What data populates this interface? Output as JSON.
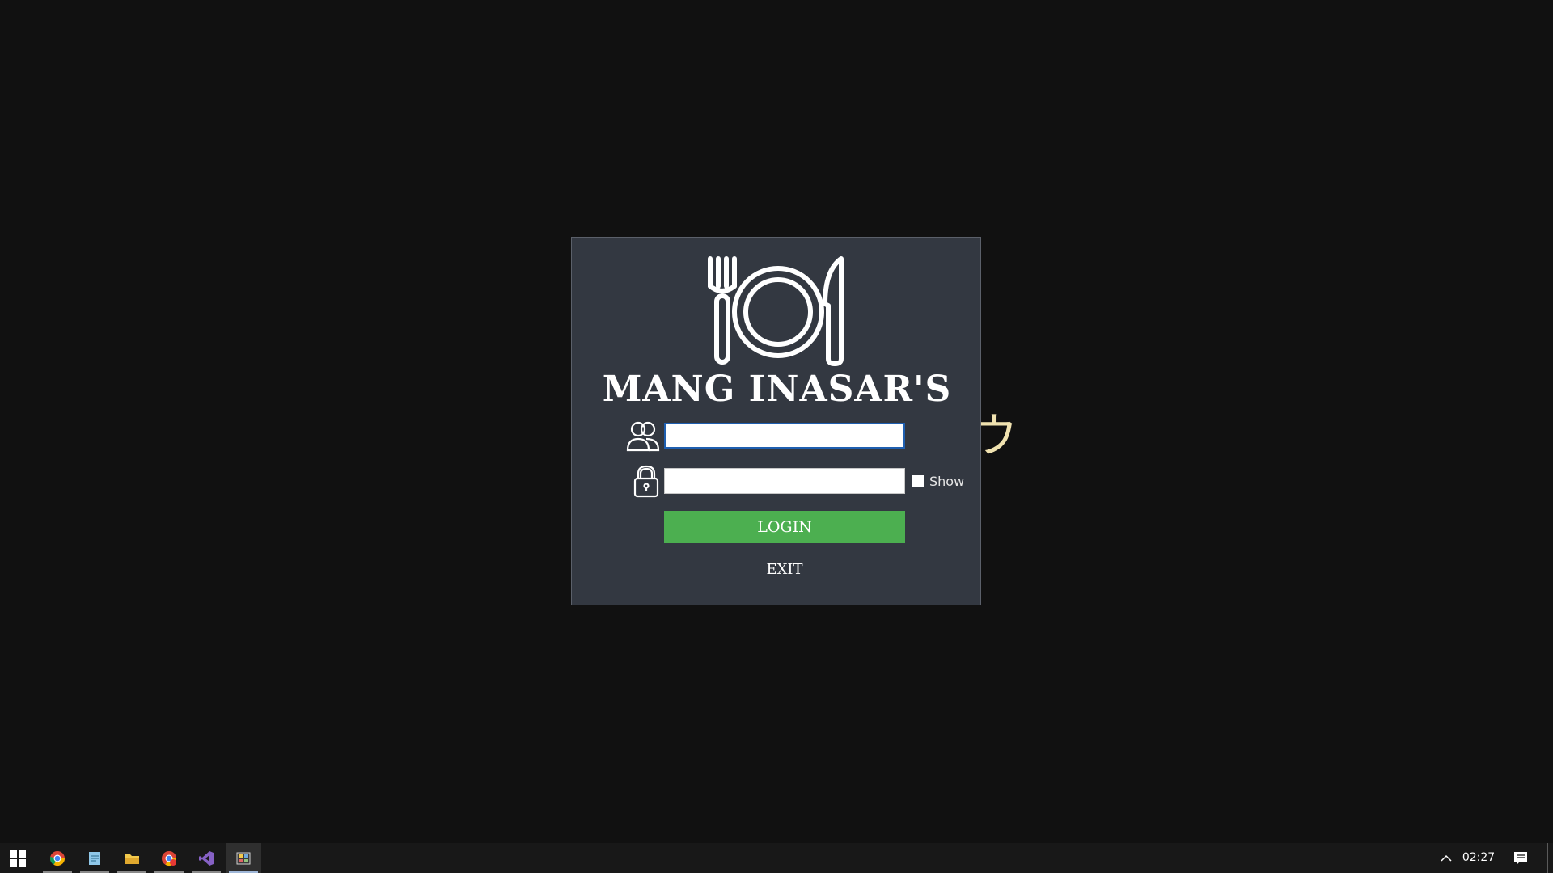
{
  "app": {
    "brand_title": "MANG INASAR'S",
    "logo_icon": "plate-fork-knife-icon",
    "username_icon": "users-icon",
    "password_icon": "lock-icon",
    "username_value": "",
    "password_value": "",
    "show_label": "Show",
    "show_checked": false,
    "login_label": "LOGIN",
    "exit_label": "EXIT",
    "colors": {
      "dialog_bg": "#333841",
      "login_button": "#4caf50",
      "desktop_bg": "#111111"
    }
  },
  "background": {
    "glyph": "ウ"
  },
  "taskbar": {
    "apps": [
      {
        "name": "chrome-icon"
      },
      {
        "name": "notepad-icon"
      },
      {
        "name": "file-explorer-icon"
      },
      {
        "name": "chrome-alt-icon"
      },
      {
        "name": "visual-studio-icon"
      },
      {
        "name": "running-app-icon",
        "active": true
      }
    ],
    "clock": "02:27"
  }
}
